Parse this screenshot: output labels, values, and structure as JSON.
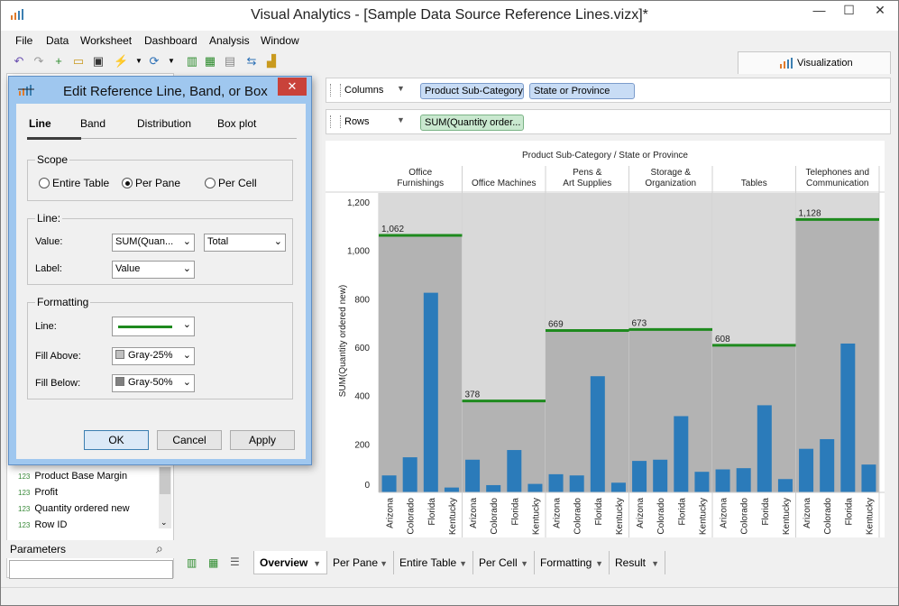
{
  "window": {
    "title": "Visual Analytics - [Sample Data Source Reference Lines.vizx]*",
    "minimize": "—",
    "maximize": "☐",
    "close": "✕"
  },
  "menu": [
    "File",
    "Data",
    "Worksheet",
    "Dashboard",
    "Analysis",
    "Window"
  ],
  "visualization_tab": "Visualization",
  "shelves": {
    "columns_label": "Columns",
    "rows_label": "Rows",
    "columns_pills": [
      "Product Sub-Category",
      "State or Province"
    ],
    "rows_pills": [
      "SUM(Quantity order..."
    ]
  },
  "fields": [
    {
      "type": "123",
      "name": "Product Base Margin"
    },
    {
      "type": "123",
      "name": "Profit"
    },
    {
      "type": "123",
      "name": "Quantity ordered new"
    },
    {
      "type": "123",
      "name": "Row ID"
    }
  ],
  "parameters_label": "Parameters",
  "sheet_tabs": [
    "Overview",
    "Per Pane",
    "Entire Table",
    "Per Cell",
    "Formatting",
    "Result"
  ],
  "active_sheet": "Overview",
  "dialog": {
    "title": "Edit Reference Line, Band, or Box",
    "close": "✕",
    "tabs": [
      "Line",
      "Band",
      "Distribution",
      "Box plot"
    ],
    "active_tab": "Line",
    "scope": {
      "title": "Scope",
      "options": [
        "Entire Table",
        "Per Pane",
        "Per Cell"
      ],
      "selected": "Per Pane"
    },
    "line": {
      "title": "Line:",
      "value_label": "Value:",
      "value_field": "SUM(Quan...",
      "value_agg": "Total",
      "label_label": "Label:",
      "label_value": "Value"
    },
    "formatting": {
      "title": "Formatting",
      "line_label": "Line:",
      "line_color": "#1e8a1e",
      "fill_above_label": "Fill Above:",
      "fill_above": "Gray-25%",
      "fill_above_color": "#c0c0c0",
      "fill_below_label": "Fill Below:",
      "fill_below": "Gray-50%",
      "fill_below_color": "#808080"
    },
    "buttons": {
      "ok": "OK",
      "cancel": "Cancel",
      "apply": "Apply"
    }
  },
  "chart_data": {
    "type": "bar",
    "title": "Product Sub-Category / State or Province",
    "ylabel": "SUM(Quantity ordered new)",
    "ylim": [
      0,
      1200
    ],
    "yticks": [
      0,
      200,
      400,
      600,
      800,
      "1,000",
      "1,200"
    ],
    "bar_color": "#2b7bba",
    "reference_line_color": "#1e8a1e",
    "fill_above_color": "#d9d9d9",
    "fill_below_color": "#b3b3b3",
    "states": [
      "Arizona",
      "Colorado",
      "Florida",
      "Kentucky"
    ],
    "panes": [
      {
        "name": "Office Furnishings",
        "values": [
          70,
          145,
          825,
          20
        ],
        "ref": 1062,
        "ref_label": "1,062"
      },
      {
        "name": "Office Machines",
        "values": [
          135,
          30,
          175,
          35
        ],
        "ref": 378,
        "ref_label": "378"
      },
      {
        "name": "Pens & Art Supplies",
        "values": [
          75,
          70,
          480,
          40
        ],
        "ref": 669,
        "ref_label": "669"
      },
      {
        "name": "Storage & Organization",
        "values": [
          130,
          135,
          315,
          85
        ],
        "ref": 673,
        "ref_label": "673"
      },
      {
        "name": "Tables",
        "values": [
          95,
          100,
          360,
          55
        ],
        "ref": 608,
        "ref_label": "608"
      },
      {
        "name": "Telephones and Communication",
        "values": [
          180,
          220,
          615,
          115
        ],
        "ref": 1128,
        "ref_label": "1,128"
      }
    ]
  }
}
